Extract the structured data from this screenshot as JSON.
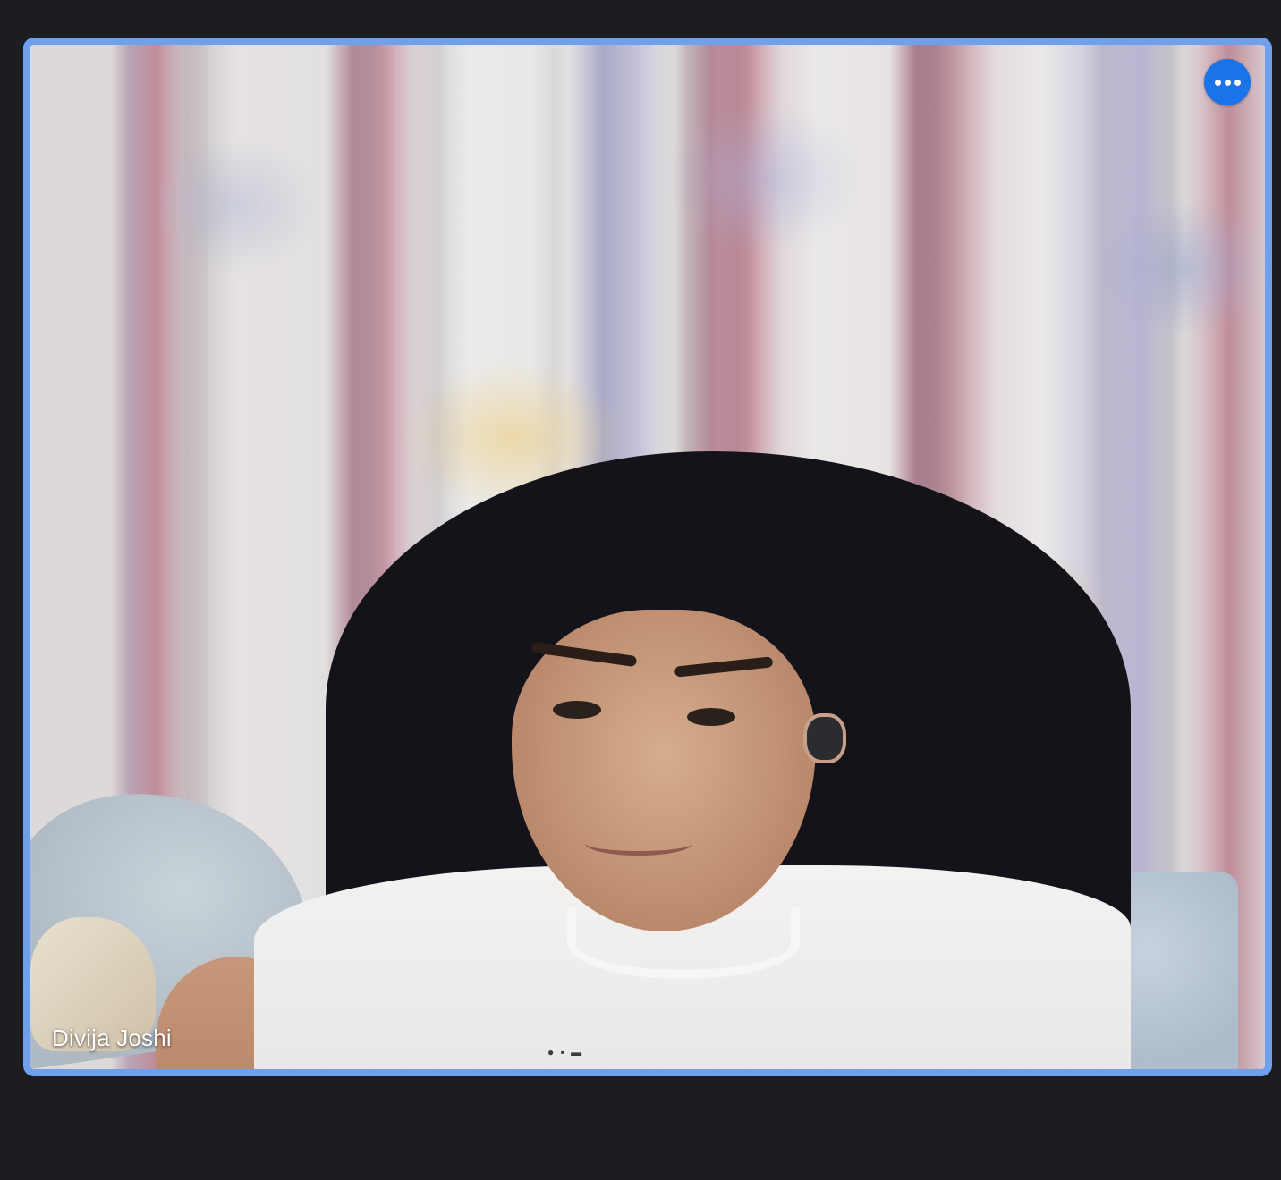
{
  "participant": {
    "name": "Divija Joshi"
  },
  "controls": {
    "more_options_icon": "more-horiz-icon"
  },
  "colors": {
    "background": "#1c1d20",
    "active_speaker_border": "#6fa0ec",
    "button_blue": "#1a73e8"
  }
}
